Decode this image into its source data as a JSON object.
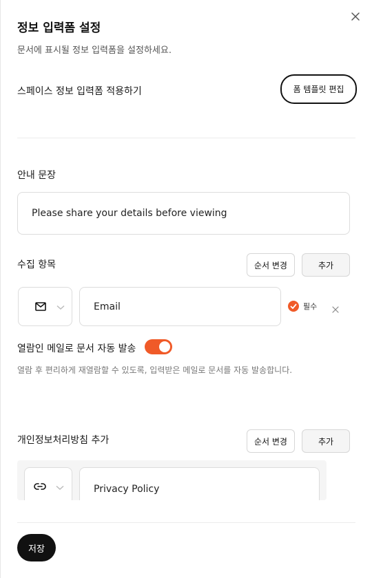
{
  "header": {
    "title": "정보 입력폼 설정",
    "subtitle": "문서에 표시될 정보 입력폼을 설정하세요."
  },
  "space_form": {
    "label": "스페이스 정보 입력폼 적용하기",
    "edit_template_label": "폼 템플릿 편집"
  },
  "guide": {
    "label": "안내 문장",
    "value": "Please share your details before viewing"
  },
  "collect": {
    "label": "수집 항목",
    "reorder_label": "순서 변경",
    "add_label": "추가",
    "items": [
      {
        "icon": "mail-icon",
        "value": "Email",
        "required_label": "필수"
      }
    ]
  },
  "auto_send": {
    "label": "열람인 메일로 문서 자동 발송",
    "enabled": true,
    "helper": "열람 후 편리하게 재열람할 수 있도록, 입력받은 메일로 문서를 자동 발송합니다."
  },
  "privacy": {
    "label": "개인정보처리방침 추가",
    "reorder_label": "순서 변경",
    "add_label": "추가",
    "items": [
      {
        "icon": "link-icon",
        "value": "Privacy Policy"
      }
    ]
  },
  "footer": {
    "save_label": "저장"
  },
  "colors": {
    "accent": "#f05a28",
    "primary_button": "#111111"
  }
}
